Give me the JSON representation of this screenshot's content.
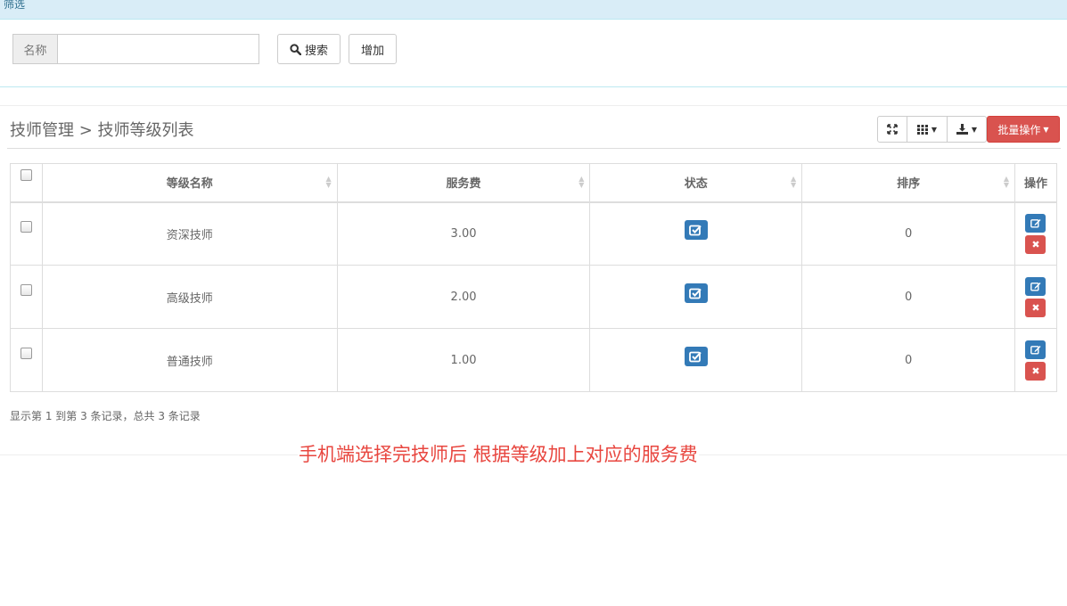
{
  "filter": {
    "title": "筛选",
    "name_label": "名称",
    "name_value": "",
    "search_label": "搜索",
    "add_label": "增加"
  },
  "breadcrumb": "技师管理 > 技师等级列表",
  "toolbar": {
    "fullscreen_icon": "fullscreen-icon",
    "columns_icon": "grid-icon",
    "export_icon": "export-icon",
    "batch_label": "批量操作"
  },
  "table": {
    "headers": [
      "等级名称",
      "服务费",
      "状态",
      "排序",
      "操作"
    ],
    "rows": [
      {
        "name": "资深技师",
        "fee": "3.00",
        "sort": "0"
      },
      {
        "name": "高级技师",
        "fee": "2.00",
        "sort": "0"
      },
      {
        "name": "普通技师",
        "fee": "1.00",
        "sort": "0"
      }
    ]
  },
  "pagination": "显示第 1 到第 3 条记录，总共 3 条记录",
  "note": "手机端选择完技师后  根据等级加上对应的服务费",
  "colors": {
    "primary": "#337ab7",
    "danger": "#d9534f",
    "note": "#e8463f",
    "header_bg": "#d9edf7"
  }
}
